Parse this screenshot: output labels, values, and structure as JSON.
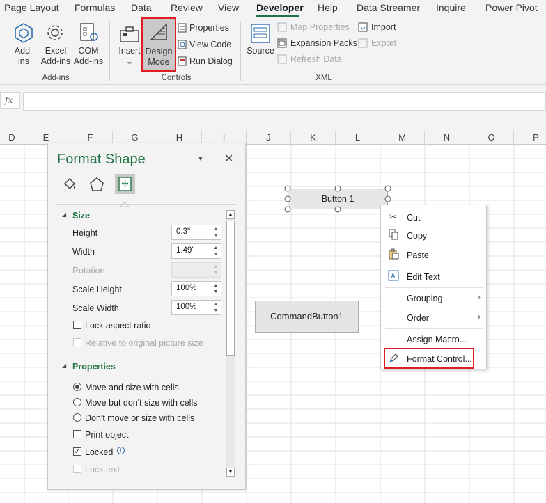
{
  "tabs": [
    "Page Layout",
    "Formulas",
    "Data",
    "Review",
    "View",
    "Developer",
    "Help",
    "Data Streamer",
    "Inquire",
    "Power Pivot"
  ],
  "active_tab": "Developer",
  "ribbon": {
    "addins": {
      "addins_label": "Add-\nins",
      "excel_addins_label": "Excel\nAdd-ins",
      "com_addins_label": "COM\nAdd-ins",
      "group_label": "Add-ins"
    },
    "controls": {
      "insert_label": "Insert",
      "design_mode_label": "Design\nMode",
      "properties_label": "Properties",
      "view_code_label": "View Code",
      "run_dialog_label": "Run Dialog",
      "group_label": "Controls"
    },
    "xml": {
      "source_label": "Source",
      "map_properties_label": "Map Properties",
      "expansion_packs_label": "Expansion Packs",
      "refresh_data_label": "Refresh Data",
      "import_label": "Import",
      "export_label": "Export",
      "group_label": "XML"
    }
  },
  "formula_bar": {
    "fx_label": "fx",
    "value": ""
  },
  "columns": [
    "D",
    "E",
    "F",
    "G",
    "H",
    "I",
    "J",
    "K",
    "L",
    "M",
    "N",
    "O",
    "P"
  ],
  "format_shape": {
    "title": "Format Shape",
    "size_section": "Size",
    "height_label": "Height",
    "height_value": "0.3\"",
    "width_label": "Width",
    "width_value": "1.49\"",
    "rotation_label": "Rotation",
    "scale_height_label": "Scale Height",
    "scale_height_value": "100%",
    "scale_width_label": "Scale Width",
    "scale_width_value": "100%",
    "lock_aspect_label": "Lock aspect ratio",
    "relative_label": "Relative to original picture size",
    "properties_section": "Properties",
    "move_size_label": "Move and size with cells",
    "move_no_size_label": "Move but don't size with cells",
    "dont_move_label": "Don't move or size with cells",
    "print_object_label": "Print object",
    "locked_label": "Locked",
    "lock_text_label": "Lock text"
  },
  "sheet": {
    "button1_label": "Button 1",
    "command_button_label": "CommandButton1"
  },
  "context_menu": {
    "cut": "Cut",
    "copy": "Copy",
    "paste": "Paste",
    "edit_text": "Edit Text",
    "grouping": "Grouping",
    "order": "Order",
    "assign_macro": "Assign Macro...",
    "format_control": "Format Control..."
  },
  "colors": {
    "accent_green": "#217346",
    "highlight_red": "#e01b24"
  }
}
